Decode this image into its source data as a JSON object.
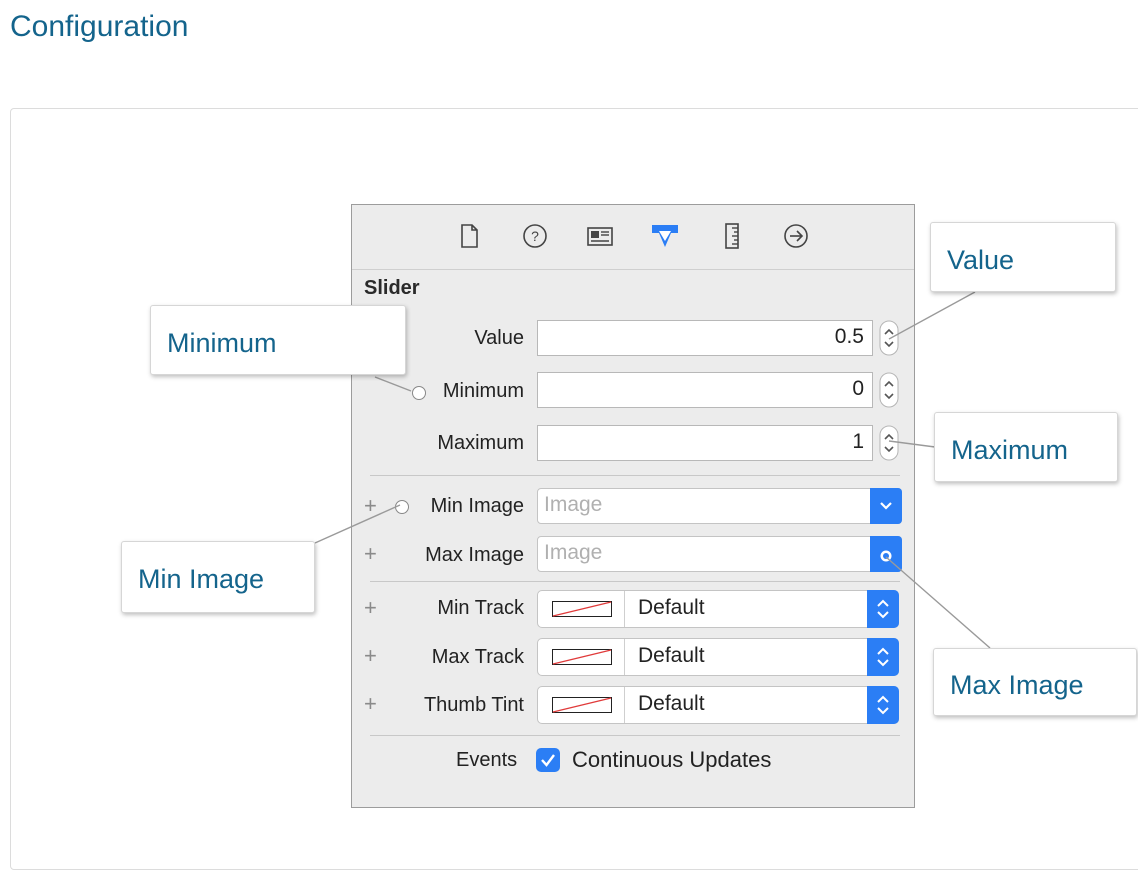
{
  "page": {
    "title": "Configuration"
  },
  "inspector": {
    "toolbar_icons": [
      "file-icon",
      "help-icon",
      "identity-icon",
      "attributes-icon",
      "size-ruler-icon",
      "connections-icon"
    ],
    "section_title": "Slider",
    "value": {
      "label": "Value",
      "value": "0.5"
    },
    "minimum": {
      "label": "Minimum",
      "value": "0"
    },
    "maximum": {
      "label": "Maximum",
      "value": "1"
    },
    "min_image": {
      "label": "Min Image",
      "placeholder": "Image"
    },
    "max_image": {
      "label": "Max Image",
      "placeholder": "Image"
    },
    "min_track": {
      "label": "Min Track",
      "value": "Default"
    },
    "max_track": {
      "label": "Max Track",
      "value": "Default"
    },
    "thumb_tint": {
      "label": "Thumb Tint",
      "value": "Default"
    },
    "events": {
      "label": "Events",
      "checkbox_label": "Continuous Updates",
      "checked": true
    }
  },
  "callouts": {
    "value": "Value",
    "minimum": "Minimum",
    "maximum": "Maximum",
    "min_image": "Min Image",
    "max_image": "Max Image"
  },
  "colors": {
    "accent": "#2b7ef5",
    "title": "#14648c"
  }
}
